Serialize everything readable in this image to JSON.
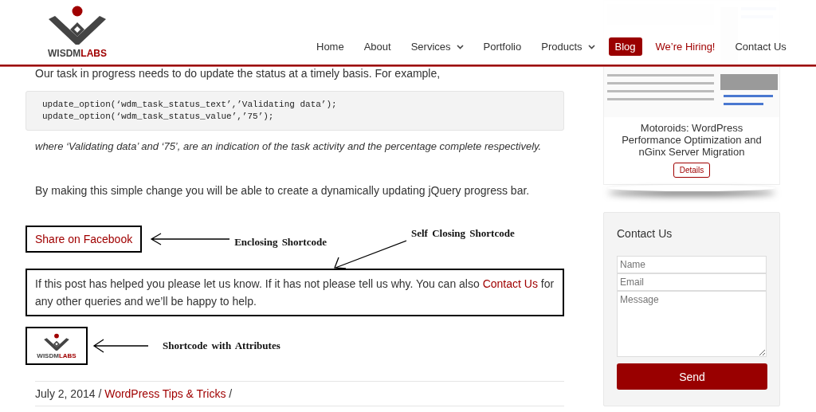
{
  "header": {
    "logo": {
      "word_dark": "WISDM",
      "word_red": "LABS"
    },
    "nav": [
      {
        "label": "Home",
        "kind": "link",
        "dropdown": false,
        "selected": false
      },
      {
        "label": "About",
        "kind": "link",
        "dropdown": false,
        "selected": false
      },
      {
        "label": "Services",
        "kind": "link",
        "dropdown": true,
        "selected": false
      },
      {
        "label": "Portfolio",
        "kind": "link",
        "dropdown": false,
        "selected": false
      },
      {
        "label": "Products",
        "kind": "link",
        "dropdown": true,
        "selected": false
      },
      {
        "label": "Blog",
        "kind": "link",
        "dropdown": false,
        "selected": true
      },
      {
        "label": "We’re Hiring!",
        "kind": "highlight",
        "dropdown": false,
        "selected": false
      },
      {
        "label": "Contact Us",
        "kind": "link",
        "dropdown": false,
        "selected": false
      }
    ]
  },
  "article": {
    "intro": "Our task in progress needs to do update the status at a timely basis. For example,",
    "code": [
      "update_option(‘wdm_task_status_text’,’Validating data’);",
      "update_option(‘wdm_task_status_value’,’75’);"
    ],
    "note": "where ‘Validating data’ and ‘75’, are an indication of the task activity and the percentage complete respectively.",
    "summary": "By making this simple change you will be able to create a dynamically updating jQuery progress bar.",
    "share_link": "Share on Facebook",
    "contact_text_before": "If this post has helped you please let us know. If it has not please tell us why. You can also",
    "contact_link": "Contact Us",
    "contact_text_after": "for any other queries and we’ll be happy to help.",
    "annotations": [
      "Enclosing Shortcode",
      "Self Closing Shortcode",
      "Shortcode with Attributes"
    ],
    "shortcode_logo": {
      "word_dark": "WISDM",
      "word_red": "LABS"
    },
    "meta": {
      "date": "July 2, 2014",
      "separator": "/",
      "category": "WordPress Tips & Tricks",
      "trailing": "/"
    }
  },
  "sidebar": {
    "featured": {
      "kind": "picture",
      "title": "Motoroids: WordPress Performance Optimization and nGinx Server Migration",
      "button": "Details"
    },
    "contact": {
      "title": "Contact Us",
      "fields": [
        {
          "placeholder": "Name",
          "kind": "input"
        },
        {
          "placeholder": "Email",
          "kind": "input"
        },
        {
          "placeholder": "Message",
          "kind": "textarea"
        }
      ],
      "button": "Send"
    }
  }
}
